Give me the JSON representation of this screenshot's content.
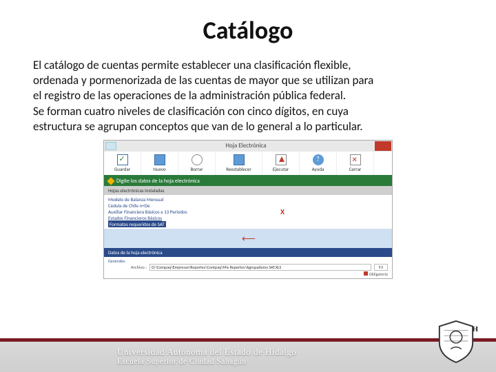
{
  "title": "Catálogo",
  "body": {
    "p1": "El catálogo de cuentas permite establecer una clasificación flexible, ordenada y pormenorizada de las cuentas de mayor que se utilizan para el registro de las operaciones de la administración pública federal.",
    "p2": "Se forman cuatro niveles de clasificación con cinco dígitos, en cuya estructura se agrupan conceptos que van de lo general a lo particular."
  },
  "embed": {
    "window_title": "Hoja Electrónica",
    "toolbar": [
      {
        "label": "Guardar",
        "icon": "check"
      },
      {
        "label": "Nuevo",
        "icon": "blue"
      },
      {
        "label": "Borrar",
        "icon": "mag"
      },
      {
        "label": "Reestablecer",
        "icon": "blue"
      },
      {
        "label": "Ejecutar",
        "icon": "red"
      },
      {
        "label": "Ayuda",
        "icon": "q"
      },
      {
        "label": "Cerrar",
        "icon": "x"
      }
    ],
    "green_prompt": "Digite los datos de la hoja electrónica",
    "section_header": "Hojas electrónicas instaladas",
    "list_items": [
      "Modelo de Balanza Mensual",
      "Cedula de Chile n+De",
      "Auxiliar Financiera Básicos a 13 Periodos",
      "Estados Financieros Básicos"
    ],
    "list_highlight": "Formatos requeridos de SAT",
    "darkbar": "Datos de la hoja electrónica",
    "detail_label_left": "Generales",
    "detail_label_archivo": "Archivo :",
    "detail_path": "O:\\Compaq\\Empresas\\Reportes\\Contpaq\\Mis Reportes\\Agrupadores SAT.XLS",
    "f3": "F3",
    "required": "Obligatorio"
  },
  "footer": {
    "line1": "Universidad Autónoma del Estado de Hidalgo",
    "line2": "Escuela Superior de Ciudad Sahagún",
    "acronym": "UAEH"
  }
}
